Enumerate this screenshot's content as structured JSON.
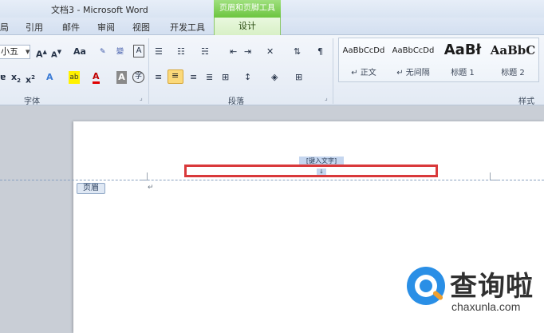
{
  "window": {
    "title": "文档3 - Microsoft Word",
    "context_tab_group": "页眉和页脚工具"
  },
  "menu_tabs": [
    "局",
    "引用",
    "邮件",
    "审阅",
    "视图",
    "开发工具"
  ],
  "active_tab": "设计",
  "ribbon": {
    "font_size_value": "小五",
    "group_font": "字体",
    "group_paragraph": "段落",
    "group_styles": "样式",
    "font_grow": "A",
    "font_shrink": "A",
    "change_case": "Aa",
    "strikethrough": "abc",
    "subscript": "x",
    "superscript": "x",
    "font_color": "A",
    "char_shading": "A",
    "enclose_char": "字"
  },
  "styles_gallery": [
    {
      "preview": "AaBbCcDd",
      "name": "↵ 正文"
    },
    {
      "preview": "AaBbCcDd",
      "name": "↵ 无间隔"
    },
    {
      "preview": "AaBł",
      "name": "标题 1"
    },
    {
      "preview": "AaBbC",
      "name": "标题 2"
    }
  ],
  "document": {
    "header_placeholder": "[键入文字]",
    "header_badge": "页眉",
    "paragraph_mark": "↵"
  },
  "watermark": {
    "title": "查询啦",
    "domain": "chaxunla.com"
  },
  "colors": {
    "context_tab": "#6cc53f",
    "highlight_box": "#d9393b",
    "watermark_blue": "#2a8fe6"
  }
}
